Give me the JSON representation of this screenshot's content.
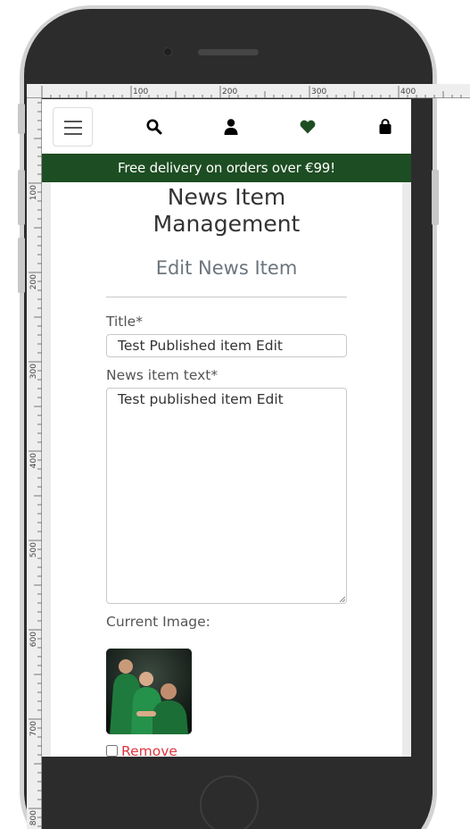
{
  "header": {
    "menu_icon": "hamburger-icon",
    "icons": [
      "search-icon",
      "user-icon",
      "heart-icon",
      "shopping-bag-icon"
    ]
  },
  "banner": {
    "text": "Free delivery on orders over €99!"
  },
  "page": {
    "title_line1": "News Item",
    "title_line2": "Management",
    "subtitle": "Edit News Item"
  },
  "form": {
    "title_label": "Title*",
    "title_value": "Test Published item Edit",
    "text_label": "News item text*",
    "text_value": "Test published item Edit",
    "current_image_label": "Current Image:",
    "remove_label": "Remove"
  },
  "ruler": {
    "top_labels": [
      "100",
      "200",
      "300",
      "400"
    ],
    "left_labels": [
      "100",
      "200",
      "300",
      "400",
      "500",
      "600",
      "700",
      "800"
    ]
  },
  "colors": {
    "banner_bg": "#1d4d22",
    "heart": "#1d4d22",
    "remove": "#e0373f"
  }
}
